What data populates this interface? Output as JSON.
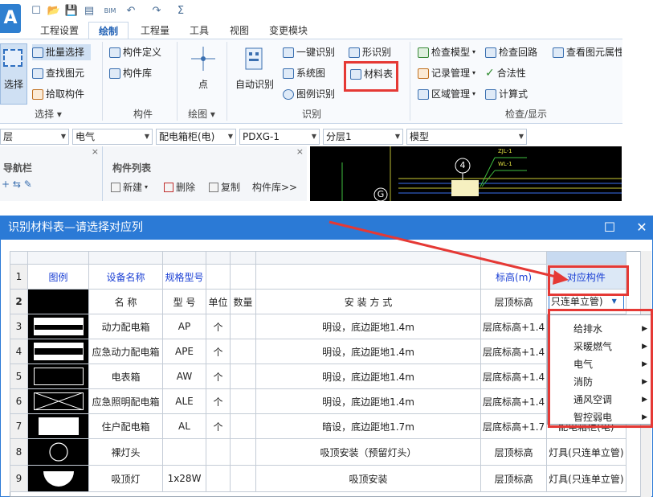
{
  "app": {
    "icon_letter": "A"
  },
  "quick_access": [
    "☐",
    "📂",
    "💾",
    "▤",
    "BIM",
    "↶",
    "↷",
    "Σ"
  ],
  "tabs": [
    {
      "label": "工程设置",
      "active": false
    },
    {
      "label": "绘制",
      "active": true
    },
    {
      "label": "工程量",
      "active": false
    },
    {
      "label": "工具",
      "active": false
    },
    {
      "label": "视图",
      "active": false
    },
    {
      "label": "变更模块",
      "active": false
    }
  ],
  "ribbon": {
    "select_group": {
      "big": "选择",
      "items": [
        "批量选择",
        "查找图元",
        "拾取构件"
      ],
      "label": "选择 ▾"
    },
    "component_group": {
      "items": [
        "构件定义",
        "构件库"
      ],
      "label": "构件"
    },
    "draw_group": {
      "big": "点",
      "label": "绘图 ▾"
    },
    "identify_group": {
      "big": "自动识别",
      "items": [
        "一键识别",
        "系统图",
        "图例识别",
        "形识别",
        "材料表"
      ],
      "label": "识别"
    },
    "check_group": {
      "items": [
        "检查模型",
        "记录管理",
        "区域管理",
        "检查回路",
        "合法性",
        "计算式",
        "查看图元属性"
      ],
      "label": "检查/显示"
    }
  },
  "selectors": {
    "floor": "层",
    "discipline": "电气",
    "type": "配电箱柜(电)",
    "component": "PDXG-1",
    "sublayer": "分层1",
    "mode": "模型"
  },
  "panels": {
    "nav": {
      "title": "导航栏"
    },
    "list": {
      "title": "构件列表",
      "new": "新建",
      "delete": "删除",
      "copy": "复制",
      "library": "构件库>>"
    }
  },
  "canvas": {
    "marker_num": "4",
    "marker_letter": "G",
    "label1": "ZJL-1",
    "label2": "WL-1"
  },
  "dialog": {
    "title": "识别材料表—请选择对应列",
    "headers": {
      "row": "1",
      "legend": "图例",
      "name": "设备名称",
      "spec": "规格型号",
      "elevation": "标高(m)",
      "component": "对应构件"
    },
    "row2": {
      "num": "2",
      "name": "名 称",
      "spec": "型 号",
      "unit": "单位",
      "qty": "数量",
      "install": "安 装 方 式",
      "elevation": "层顶标高",
      "component": "只连单立管)"
    },
    "rows": [
      {
        "num": "3",
        "name": "动力配电箱",
        "spec": "AP",
        "unit": "个",
        "install": "明设，底边距地1.4m",
        "elevation": "层底标高+1.4",
        "symbol": "panel-band"
      },
      {
        "num": "4",
        "name": "应急动力配电箱",
        "spec": "APE",
        "unit": "个",
        "install": "明设，底边距地1.4m",
        "elevation": "层底标高+1.4",
        "symbol": "panel-band"
      },
      {
        "num": "5",
        "name": "电表箱",
        "spec": "AW",
        "unit": "个",
        "install": "明设，底边距地1.4m",
        "elevation": "层底标高+1.4",
        "symbol": "panel-empty"
      },
      {
        "num": "6",
        "name": "应急照明配电箱",
        "spec": "ALE",
        "unit": "个",
        "install": "明设，底边距地1.4m",
        "elevation": "层底标高+1.4",
        "symbol": "panel-cross"
      },
      {
        "num": "7",
        "name": "住户配电箱",
        "spec": "AL",
        "unit": "个",
        "install": "暗设，底边距地1.7m",
        "elevation": "层底标高+1.7",
        "component": "配电箱柜(电)",
        "symbol": "panel-white"
      },
      {
        "num": "8",
        "name": "裸灯头",
        "spec": "",
        "unit": "",
        "install": "吸顶安装（预留灯头）",
        "elevation": "层顶标高",
        "component": "灯具(只连单立管)",
        "symbol": "circle"
      },
      {
        "num": "9",
        "name": "吸顶灯",
        "spec": "1x28W",
        "unit": "",
        "install": "吸顶安装",
        "elevation": "层顶标高",
        "component": "灯具(只连单立管)",
        "symbol": "half-circle"
      }
    ],
    "menu": [
      "给排水",
      "采暖燃气",
      "电气",
      "消防",
      "通风空调",
      "智控弱电"
    ]
  },
  "colors": {
    "accent": "#2b7ad6",
    "annotation": "#e53935"
  }
}
